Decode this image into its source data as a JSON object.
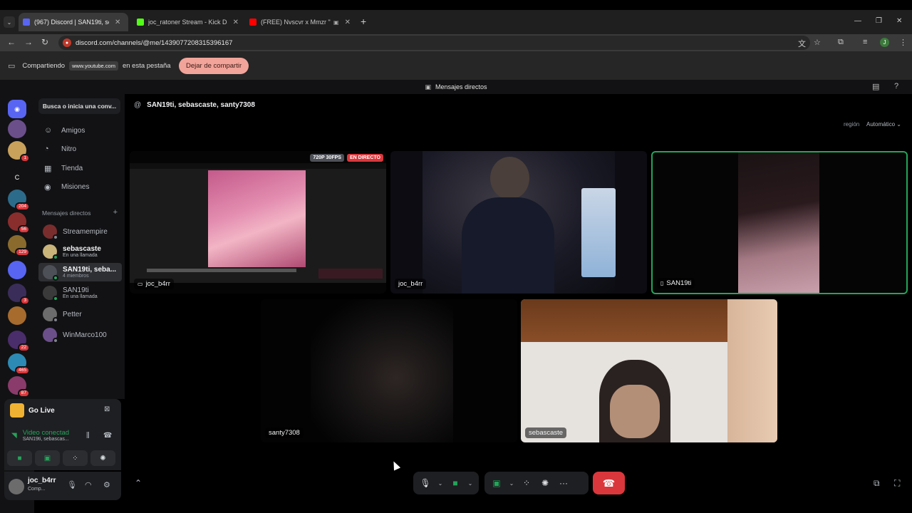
{
  "browser": {
    "tabs": [
      {
        "title": "(967) Discord | SAN19ti, seb",
        "active": true,
        "fav_color": "#5865f2"
      },
      {
        "title": "joc_ratoner Stream - Kick Dash",
        "active": false,
        "fav_color": "#53fc18"
      },
      {
        "title": "(FREE) Nvscvr x Mmzr \"Ni tu",
        "active": false,
        "fav_color": "#ff0000"
      }
    ],
    "url": "discord.com/channels/@me/1439077208315396167",
    "profile_initial": "J"
  },
  "share_bar": {
    "prefix": "Compartiendo",
    "site": "www.youtube.com",
    "suffix": "en esta pestaña",
    "stop_label": "Dejar de compartir"
  },
  "discord": {
    "window_title": "Mensajes directos",
    "servers": [
      {
        "label": "",
        "color": "#5865f2",
        "badge": ""
      },
      {
        "label": "",
        "color": "#6b4f8a",
        "badge": ""
      },
      {
        "label": "",
        "color": "#c9a15a",
        "badge": "1"
      },
      {
        "label": "C",
        "color": "#121214",
        "badge": ""
      },
      {
        "label": "",
        "color": "#2d6b8a",
        "badge": "204"
      },
      {
        "label": "",
        "color": "#8a2d2d",
        "badge": "56"
      },
      {
        "label": "",
        "color": "#8a6b2d",
        "badge": "129"
      },
      {
        "label": "",
        "color": "#5865f2",
        "badge": ""
      },
      {
        "label": "",
        "color": "#3b2d5a",
        "badge": "3"
      },
      {
        "label": "",
        "color": "#a66b2d",
        "badge": ""
      },
      {
        "label": "",
        "color": "#4a2d6b",
        "badge": "22"
      },
      {
        "label": "",
        "color": "#2d8ab5",
        "badge": "465"
      },
      {
        "label": "",
        "color": "#8a3b6b",
        "badge": "87"
      }
    ],
    "search_label": "Busca o inicia una conv...",
    "nav": [
      {
        "label": "Amigos",
        "icon": "friends-icon",
        "glyph": "☺"
      },
      {
        "label": "Nitro",
        "icon": "nitro-icon",
        "glyph": "◔"
      },
      {
        "label": "Tienda",
        "icon": "shop-icon",
        "glyph": "▦"
      },
      {
        "label": "Misiones",
        "icon": "quests-icon",
        "glyph": "◉"
      }
    ],
    "dm_header": "Mensajes directos",
    "dms": [
      {
        "name": "Streamempire",
        "sub": "",
        "color": "#7a2d2d",
        "status": "#80848e"
      },
      {
        "name": "sebascaste",
        "sub": "En una llamada",
        "color": "#c9b47a",
        "status": "#23a559",
        "bold": true
      },
      {
        "name": "SAN19ti, seba...",
        "sub": "4 miembros",
        "color": "#4e5058",
        "status": "#23a559",
        "selected": true
      },
      {
        "name": "SAN19ti",
        "sub": "En una llamada",
        "color": "#3a3a3a",
        "status": "#23a559"
      },
      {
        "name": "Petter",
        "sub": "",
        "color": "#6c6c6c",
        "status": "#80848e"
      },
      {
        "name": "WinMarco100",
        "sub": "",
        "color": "#6b4f8a",
        "status": "#80848e"
      }
    ],
    "voice": {
      "go_live": "Go Live",
      "status": "Video conectad",
      "channel": "SAN19ti, sebascas..."
    },
    "user": {
      "name": "joc_b4rr",
      "status": "Comp..."
    },
    "call": {
      "title": "SAN19ti, sebascaste, santy7308",
      "region_label": "región",
      "region_value": "Automático",
      "tiles": [
        {
          "name": "joc_b4rr",
          "kind": "stream",
          "quality": "720P 30FPS",
          "live": "EN DIRECTO"
        },
        {
          "name": "joc_b4rr",
          "kind": "camera"
        },
        {
          "name": "SAN19ti",
          "kind": "camera-mobile"
        },
        {
          "name": "santy7308",
          "kind": "camera-dark"
        },
        {
          "name": "sebascaste",
          "kind": "camera-bright"
        }
      ]
    }
  }
}
